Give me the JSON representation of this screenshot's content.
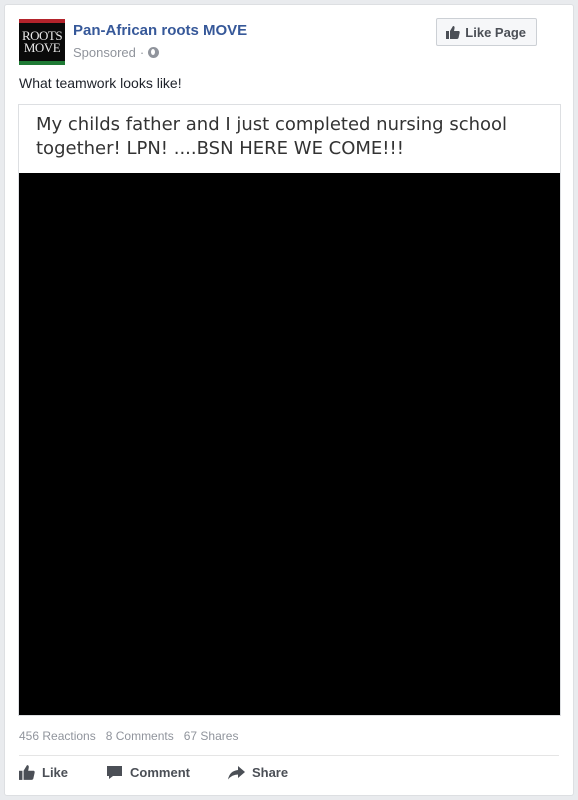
{
  "header": {
    "avatar_text": [
      "ROOTS",
      "MOVE"
    ],
    "page_name": "Pan-African roots MOVE",
    "sponsored": "Sponsored",
    "dot": "·",
    "like_page_label": "Like Page"
  },
  "post": {
    "caption": "What teamwork looks like!",
    "media_text": "My childs father and I just completed nursing school together! LPN! ....BSN HERE WE COME!!!"
  },
  "stats": {
    "reactions": "456 Reactions",
    "comments": "8 Comments",
    "shares": "67 Shares"
  },
  "actions": {
    "like": "Like",
    "comment": "Comment",
    "share": "Share"
  },
  "colors": {
    "link_blue": "#365899",
    "action_gray": "#4b4f56",
    "meta_gray": "#90949c"
  }
}
